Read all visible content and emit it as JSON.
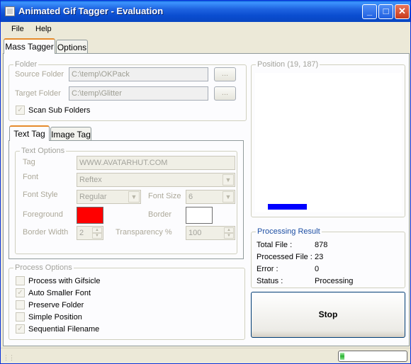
{
  "window": {
    "title": "Animated Gif Tagger - Evaluation"
  },
  "menu": {
    "file": "File",
    "help": "Help"
  },
  "main_tabs": {
    "mass_tagger": "Mass Tagger",
    "options": "Options"
  },
  "folder": {
    "legend": "Folder",
    "source_label": "Source Folder",
    "source_value": "C:\\temp\\OKPack",
    "target_label": "Target Folder",
    "target_value": "C:\\temp\\Glitter",
    "browse_label": "...",
    "scan_sub_label": "Scan Sub Folders",
    "scan_sub_checked": true
  },
  "tag_tabs": {
    "text_tag": "Text Tag",
    "image_tag": "Image Tag"
  },
  "text_options": {
    "legend": "Text Options",
    "tag_label": "Tag",
    "tag_value": "WWW.AVATARHUT.COM",
    "font_label": "Font",
    "font_value": "Reftex",
    "font_style_label": "Font Style",
    "font_style_value": "Regular",
    "font_size_label": "Font Size",
    "font_size_value": "6",
    "foreground_label": "Foreground",
    "foreground_color": "#ff0000",
    "border_label": "Border",
    "border_color": "#ffffff",
    "border_width_label": "Border Width",
    "border_width_value": "2",
    "transparency_label": "Transparency %",
    "transparency_value": "100"
  },
  "process_options": {
    "legend": "Process Options",
    "items": [
      {
        "label": "Process with Gifsicle",
        "checked": false
      },
      {
        "label": "Auto Smaller Font",
        "checked": true
      },
      {
        "label": "Preserve Folder",
        "checked": false
      },
      {
        "label": "Simple Position",
        "checked": false
      },
      {
        "label": "Sequential Filename",
        "checked": true
      }
    ]
  },
  "position": {
    "legend": "Position (19, 187)",
    "marker_color": "#0000ff"
  },
  "processing_result": {
    "legend": "Processing Result",
    "total_label": "Total File :",
    "total_value": "878",
    "processed_label": "Processed File :",
    "processed_value": "23",
    "error_label": "Error :",
    "error_value": "0",
    "status_label": "Status :",
    "status_value": "Processing"
  },
  "stop_button": "Stop",
  "statusbar": {
    "progress_fraction": 0.03
  }
}
